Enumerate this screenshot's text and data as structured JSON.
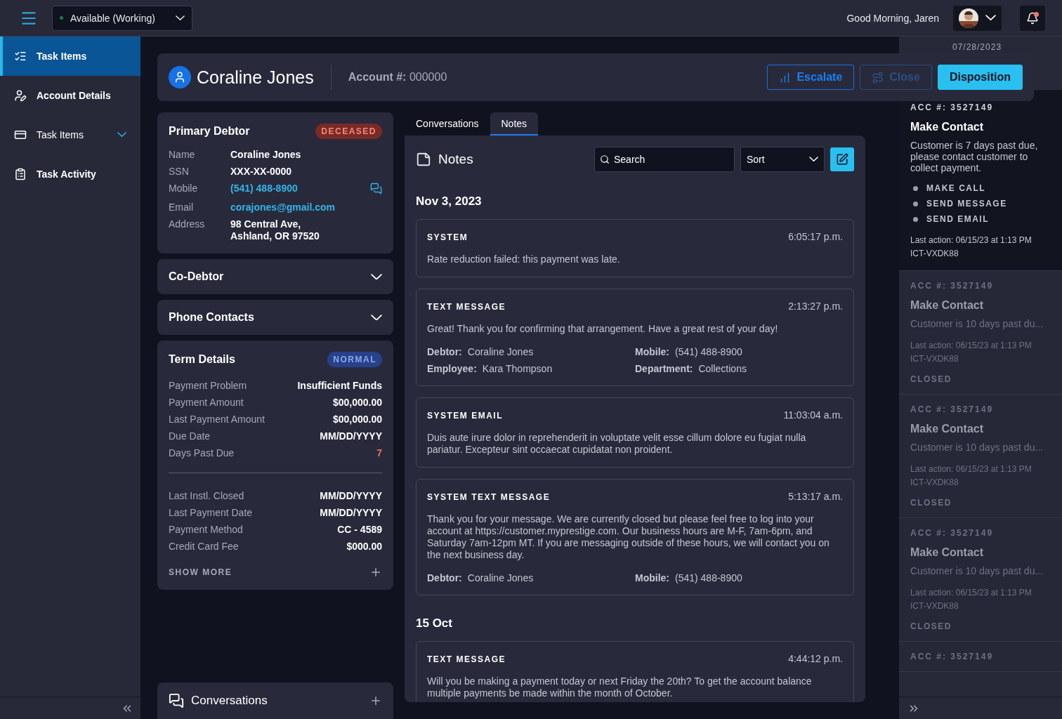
{
  "top_bar": {
    "status": {
      "label": "Available (Working)",
      "color": "#1f7a4d"
    },
    "greeting": "Good Morning, Jaren",
    "notification_unread": true
  },
  "sidebar": {
    "items": [
      {
        "label": "Task Items",
        "kind": "link",
        "selected": true
      },
      {
        "label": "Account Details",
        "kind": "link",
        "selected": false
      },
      {
        "label": "Task Items",
        "kind": "group",
        "selected": false
      },
      {
        "label": "Task Activity",
        "kind": "link",
        "selected": false
      }
    ]
  },
  "header": {
    "name": "Coraline Jones",
    "account_label": "Account #:",
    "account_value": "000000",
    "buttons": [
      {
        "label": "Escalate",
        "kind": "outline",
        "disabled": false
      },
      {
        "label": "Close",
        "kind": "outline",
        "disabled": true
      },
      {
        "label": "Disposition",
        "kind": "primary",
        "disabled": false
      }
    ]
  },
  "primary_debtor": {
    "title": "Primary Debtor",
    "badge": "DECEASED",
    "rows": [
      {
        "label": "Name",
        "value": "Coraline Jones",
        "kind": "text"
      },
      {
        "label": "SSN",
        "value": "XXX-XX-0000",
        "kind": "text"
      },
      {
        "label": "Mobile",
        "value": "(541) 488-8900",
        "kind": "phone"
      },
      {
        "label": "Email",
        "value": "corajones@gmail.com",
        "kind": "link"
      },
      {
        "label": "Address",
        "value": "98 Central Ave,\nAshland, OR 97520",
        "kind": "text"
      }
    ]
  },
  "collapsibles": [
    {
      "title": "Co-Debtor",
      "expanded": false
    },
    {
      "title": "Phone Contacts",
      "expanded": false
    }
  ],
  "term_details": {
    "title": "Term Details",
    "badge": "NORMAL",
    "groups": [
      [
        {
          "label": "Payment Problem",
          "value": "Insufficient Funds",
          "warning": false
        },
        {
          "label": "Payment Amount",
          "value": "$00,000.00",
          "warning": false
        },
        {
          "label": "Last Payment Amount",
          "value": "$00,000.00",
          "warning": false
        },
        {
          "label": "Due Date",
          "value": "MM/DD/YYYY",
          "warning": false
        },
        {
          "label": "Days Past Due",
          "value": "7",
          "warning": true
        }
      ],
      [
        {
          "label": "Last Instl. Closed",
          "value": "MM/DD/YYYY",
          "warning": false
        },
        {
          "label": "Last Payment Date",
          "value": "MM/DD/YYYY",
          "warning": false
        },
        {
          "label": "Payment Method",
          "value": "CC - 4589",
          "warning": false
        },
        {
          "label": "Credit Card Fee",
          "value": "$000.00",
          "warning": false
        }
      ]
    ],
    "show_more": "SHOW MORE"
  },
  "conversations_card": {
    "title": "Conversations"
  },
  "tabs": [
    {
      "label": "Conversations",
      "selected": false
    },
    {
      "label": "Notes",
      "selected": true
    }
  ],
  "notes": {
    "title": "Notes",
    "search": {
      "placeholder": "Search"
    },
    "sort": {
      "value": "Sort"
    },
    "days": [
      {
        "date": "Nov 3, 2023",
        "entries": [
          {
            "type": "SYSTEM",
            "time": "6:05:17 p.m.",
            "body": "Rate reduction failed: this payment was late."
          },
          {
            "type": "TEXT MESSAGE",
            "time": "2:13:27 p.m.",
            "body": "Great! Thank you for confirming that arrangement. Have a great rest of your day!",
            "fields": [
              {
                "label": "Debtor:",
                "value": "Coraline Jones"
              },
              {
                "label": "Mobile:",
                "value": "(541) 488-8900"
              },
              {
                "label": "Employee:",
                "value": "Kara Thompson"
              },
              {
                "label": "Department:",
                "value": "Collections"
              }
            ]
          },
          {
            "type": "SYSTEM EMAIL",
            "time": "11:03:04 a.m.",
            "body": "Duis aute irure dolor in reprehenderit in voluptate velit esse cillum dolore eu fugiat nulla pariatur. Excepteur sint occaecat cupidatat non proident."
          },
          {
            "type": "SYSTEM TEXT MESSAGE",
            "time": "5:13:17 a.m.",
            "body": "Thank you for your message. We are currently closed but please feel free to log into your account at https://customer.myprestige.com. Our business hours are M-F, 7am-6pm, and Saturday 7am-12pm MT. If you are messaging outside of these hours, we will contact you on the next business day.",
            "fields": [
              {
                "label": "Debtor:",
                "value": "Coraline Jones"
              },
              {
                "label": "Mobile:",
                "value": "(541) 488-8900"
              }
            ]
          }
        ]
      },
      {
        "date": "15 Oct",
        "entries": [
          {
            "type": "TEXT MESSAGE",
            "time": "4:44:12 p.m.",
            "body": "Will you be making a payment today or next Friday the 20th? To get the account balance multiple payments be made within the month of October."
          }
        ]
      }
    ]
  },
  "task_panel": {
    "date": "07/28/2023",
    "tasks": [
      {
        "account": "ACC #: 3527149",
        "title": "Make Contact",
        "description": "Customer is 7 days past due, please contact customer to collect payment.",
        "actions": [
          "MAKE CALL",
          "SEND MESSAGE",
          "SEND EMAIL"
        ],
        "last_action": "Last action: 06/15/23 at 1:13 PM",
        "code": "ICT-VXDK88",
        "selected": true
      },
      {
        "account": "ACC #: 3527149",
        "title": "Make Contact",
        "description": "Customer is 10 days past du...",
        "last_action": "Last action: 06/15/23 at 1:13 PM",
        "code": "ICT-VXDK88",
        "status": "CLOSED",
        "selected": false
      },
      {
        "account": "ACC #: 3527149",
        "title": "Make Contact",
        "description": "Customer is 10 days past du...",
        "last_action": "Last action: 06/15/23 at 1:13 PM",
        "code": "ICT-VXDK88",
        "status": "CLOSED",
        "selected": false
      },
      {
        "account": "ACC #: 3527149",
        "title": "Make Contact",
        "description": "Customer is 10 days past du...",
        "last_action": "Last action: 06/15/23 at 1:13 PM",
        "code": "ICT-VXDK88",
        "status": "CLOSED",
        "selected": false
      },
      {
        "account": "ACC #: 3527149",
        "selected": false
      }
    ]
  }
}
